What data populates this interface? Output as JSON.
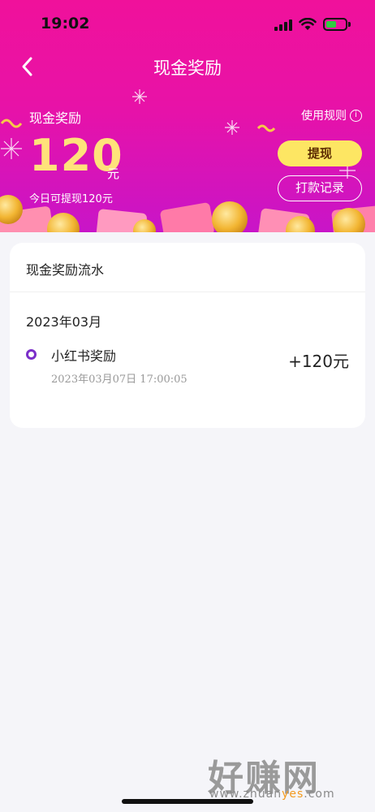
{
  "status_bar": {
    "time": "19:02"
  },
  "nav": {
    "title": "现金奖励"
  },
  "hero": {
    "label": "现金奖励",
    "rules_label": "使用规则",
    "amount": "120",
    "unit": "元",
    "today_text": "今日可提现120元",
    "withdraw_label": "提现",
    "records_label": "打款记录"
  },
  "card": {
    "title": "现金奖励流水",
    "month": "2023年03月",
    "items": [
      {
        "title": "小红书奖励",
        "time": "2023年03月07日 17:00:05",
        "amount": "+120元"
      }
    ]
  },
  "watermark": {
    "big": "好赚网",
    "small_a": "www.zhuan",
    "small_b": "yes",
    "small_c": ".com"
  },
  "colors": {
    "hero_top": "#f0119b",
    "hero_bottom": "#c815c8",
    "button_yellow": "#fde663",
    "dot_purple": "#7b2fc9"
  },
  "icons": [
    "back-arrow-icon",
    "info-icon",
    "signal-icon",
    "wifi-icon",
    "battery-icon"
  ]
}
